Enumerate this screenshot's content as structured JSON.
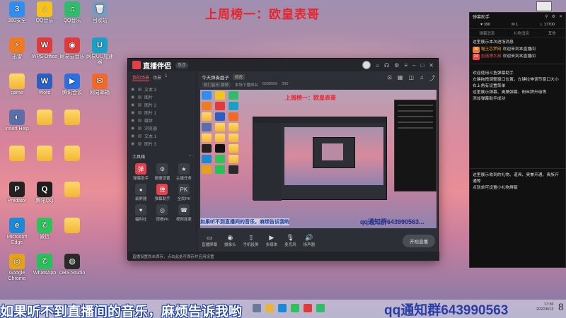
{
  "banners": {
    "top": "上周榜一：欧皇表哥",
    "bottom_left": "如果听不到直播间的音乐，麻烦告诉我哟",
    "bottom_right": "qq通知群643990563"
  },
  "desktop": {
    "icons": [
      {
        "label": "360安全",
        "color": "#2f8ff0",
        "glyph": "3",
        "col": 0,
        "row": 0
      },
      {
        "label": "QQ音乐",
        "color": "#f5c31e",
        "glyph": "♪",
        "col": 1,
        "row": 0
      },
      {
        "label": "QQ音乐",
        "color": "#2fbd6b",
        "glyph": "♫",
        "col": 2,
        "row": 0
      },
      {
        "label": "回收站",
        "color": "#7a9bbd",
        "glyph": "🗑",
        "col": 3,
        "row": 0
      },
      {
        "label": "迅雷",
        "color": "#f07a22",
        "glyph": "⚡",
        "col": 0,
        "row": 1
      },
      {
        "label": "WPS Office",
        "color": "#e23a3a",
        "glyph": "W",
        "col": 1,
        "row": 1
      },
      {
        "label": "网易云音乐",
        "color": "#e23a3a",
        "glyph": "◉",
        "col": 2,
        "row": 1
      },
      {
        "label": "网易UU加速器",
        "color": "#1aa0c8",
        "glyph": "U",
        "col": 3,
        "row": 1
      },
      {
        "label": "game",
        "color": "",
        "glyph": "",
        "col": 0,
        "row": 2,
        "folder": true
      },
      {
        "label": "Word",
        "color": "#2b5fc4",
        "glyph": "W",
        "col": 1,
        "row": 2
      },
      {
        "label": "腾讯会议",
        "color": "#2b6fe0",
        "glyph": "▶",
        "col": 2,
        "row": 2
      },
      {
        "label": "网易邮箱",
        "color": "#f06a2a",
        "glyph": "✉",
        "col": 3,
        "row": 2
      },
      {
        "label": "Insert Help",
        "color": "#5a6fa8",
        "glyph": "◐",
        "col": 0,
        "row": 3
      },
      {
        "label": "",
        "color": "",
        "glyph": "",
        "col": 1,
        "row": 3,
        "folder": true
      },
      {
        "label": "",
        "color": "",
        "glyph": "",
        "col": 2,
        "row": 3,
        "folder": true
      },
      {
        "label": "",
        "color": "",
        "glyph": "",
        "col": 0,
        "row": 4,
        "folder": true
      },
      {
        "label": "",
        "color": "",
        "glyph": "",
        "col": 1,
        "row": 4,
        "folder": true
      },
      {
        "label": "",
        "color": "",
        "glyph": "",
        "col": 2,
        "row": 4,
        "folder": true
      },
      {
        "label": "Predator",
        "color": "#222",
        "glyph": "P",
        "col": 0,
        "row": 5
      },
      {
        "label": "腾讯QQ",
        "color": "#1e1e1e",
        "glyph": "Q",
        "col": 1,
        "row": 5
      },
      {
        "label": "",
        "color": "",
        "glyph": "",
        "col": 2,
        "row": 5,
        "folder": true
      },
      {
        "label": "Microsoft Edge",
        "color": "#1b8ad6",
        "glyph": "e",
        "col": 0,
        "row": 6
      },
      {
        "label": "微信",
        "color": "#2fc25b",
        "glyph": "✆",
        "col": 1,
        "row": 6
      },
      {
        "label": "",
        "color": "",
        "glyph": "",
        "col": 2,
        "row": 6,
        "folder": true
      },
      {
        "label": "Google Chrome",
        "color": "#e3a21a",
        "glyph": "◎",
        "col": 0,
        "row": 7
      },
      {
        "label": "WhatsApp",
        "color": "#25c25a",
        "glyph": "✆",
        "col": 1,
        "row": 7
      },
      {
        "label": "OBS Studio",
        "color": "#2a2a2a",
        "glyph": "◍",
        "col": 2,
        "row": 7
      }
    ]
  },
  "app": {
    "brand": "直播伴侣",
    "version_pill": "5.0",
    "scene_tabs": [
      "我的场景",
      "场景",
      "1"
    ],
    "sources": [
      "文本 3",
      "图片",
      "图片 2",
      "图片 1",
      "媒体",
      "浏览器",
      "文本 1",
      "图片 3"
    ],
    "tools_title": "工具箱",
    "tools": [
      {
        "label": "弹幕助手",
        "glyph": "弹",
        "hot": true
      },
      {
        "label": "便捷设置",
        "glyph": "⚙",
        "hot": false
      },
      {
        "label": "主播任务",
        "glyph": "★",
        "hot": false
      },
      {
        "label": "录屏器",
        "glyph": "●",
        "hot": false
      },
      {
        "label": "弹幕助手",
        "glyph": "弹",
        "hot": true
      },
      {
        "label": "全民PK",
        "glyph": "PK",
        "hot": false
      },
      {
        "label": "福利社",
        "glyph": "♥",
        "hot": false
      },
      {
        "label": "观看PK",
        "glyph": "◎",
        "hot": false
      },
      {
        "label": "视频连麦",
        "glyph": "☎",
        "hot": false
      }
    ],
    "bottom_note": "直播设置尚未保存，点击此处可保存并应用设置",
    "stream_title": "今天弹奏曲子",
    "stream_title_tag": "修改",
    "stream_meta": [
      "热门音乐·钢琴",
      "本场下播排名",
      "8358556",
      "390"
    ],
    "preview": {
      "title": "上周榜一：欧皇表哥",
      "ticker_left": "如果听不到直播间的音乐，麻烦告诉我哟",
      "ticker_right": "qq通知群643990563..."
    },
    "bottom_tools": [
      {
        "label": "直播屏幕",
        "glyph": "▭"
      },
      {
        "label": "摄像头",
        "glyph": "◉"
      },
      {
        "label": "手机投屏",
        "glyph": "▯"
      },
      {
        "label": "多媒体",
        "glyph": "▶"
      },
      {
        "label": "麦克风",
        "glyph": "🎙"
      },
      {
        "label": "扬声器",
        "glyph": "🔊"
      }
    ],
    "start_button": "开始直播"
  },
  "chat": {
    "title": "弹幕助手",
    "stats": [
      "390",
      "1",
      "17700"
    ],
    "tabs": [
      "弹幕消息",
      "礼物消息",
      "其他"
    ],
    "welcome": "这里展示本次进场消息",
    "messages": [
      {
        "level": "30",
        "user": "喵王芯罗网",
        "text": "欢迎来到本直播间"
      },
      {
        "level": "24",
        "user": "吉诺博大叔",
        "text": "欢迎来到本直播间"
      }
    ],
    "guide": [
      "欢迎使用斗鱼弹幕助手",
      "左键拖拽调整窗口位置，左键拉伸调节窗口大小",
      "右上角有设置菜单",
      "这里展示弹幕、奥兼弹幕、粉丝牌升级等",
      "添加弹幕助手成功"
    ],
    "gift_notes": [
      "这里展示收到的礼物、道具、奥兼开通、贵族开通等",
      "点就单可设置小礼物屏蔽"
    ]
  },
  "taskbar": {
    "time": "17:36",
    "date": "2022/8/13",
    "extra": "8",
    "icons": [
      "#6a7a9a",
      "#e8b43a",
      "#1b8ad6",
      "#2fc25b",
      "#e23a3a",
      "#2fbd6b"
    ]
  }
}
